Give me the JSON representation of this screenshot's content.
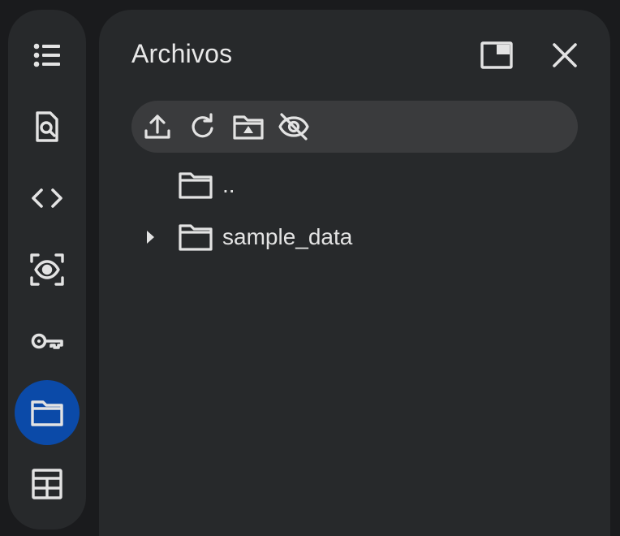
{
  "rail": {
    "items": [
      {
        "icon": "list-icon",
        "active": false
      },
      {
        "icon": "search-document-icon",
        "active": false
      },
      {
        "icon": "code-icon",
        "active": false
      },
      {
        "icon": "eye-scan-icon",
        "active": false
      },
      {
        "icon": "key-icon",
        "active": false
      },
      {
        "icon": "folder-icon",
        "active": true
      },
      {
        "icon": "table-icon",
        "active": false
      }
    ],
    "active_color": "#0b4aa8"
  },
  "panel": {
    "title": "Archivos",
    "actions": [
      "open-in-tab-icon",
      "close-icon"
    ]
  },
  "toolbar": {
    "buttons": [
      "upload-icon",
      "refresh-icon",
      "mount-drive-icon",
      "hide-files-icon"
    ]
  },
  "tree": {
    "items": [
      {
        "label": "..",
        "icon": "folder-icon",
        "expandable": false
      },
      {
        "label": "sample_data",
        "icon": "folder-icon",
        "expandable": true
      }
    ]
  }
}
